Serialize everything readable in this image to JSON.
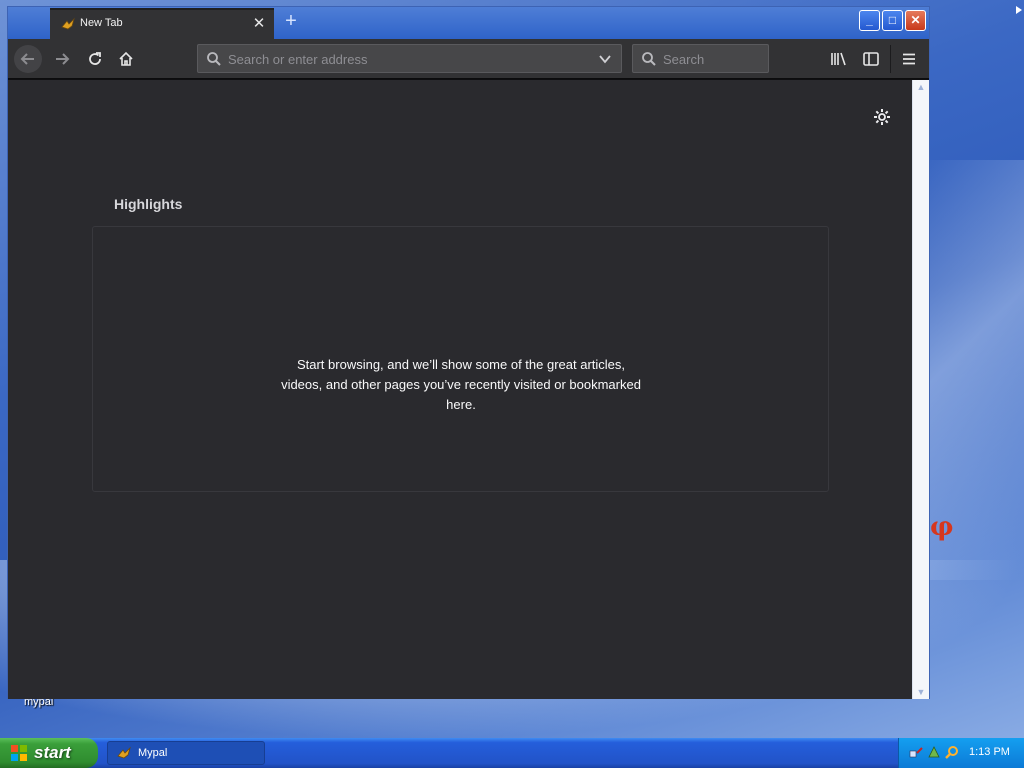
{
  "desktop": {
    "icon_label": "mypal"
  },
  "browser": {
    "tab": {
      "title": "New Tab",
      "close_symbol": "✕"
    },
    "new_tab_symbol": "+",
    "window_controls": {
      "minimize": "_",
      "maximize": "□",
      "close": "✕"
    },
    "urlbar": {
      "placeholder": "Search or enter address",
      "value": ""
    },
    "searchbar": {
      "placeholder": "Search",
      "value": ""
    },
    "icons": {
      "back": "back-arrow-icon",
      "forward": "forward-arrow-icon",
      "reload": "reload-icon",
      "home": "home-icon",
      "library": "library-icon",
      "sidebar": "sidebar-icon",
      "menu": "hamburger-menu-icon",
      "settings": "gear-icon"
    }
  },
  "newtab": {
    "highlights_title": "Highlights",
    "highlights_empty": "Start browsing, and we’ll show some of the great articles, videos, and other pages you’ve recently visited or bookmarked here."
  },
  "taskbar": {
    "start_label": "start",
    "task_label": "Mypal",
    "clock": "1:13 PM"
  },
  "colors": {
    "content_bg": "#2a2a2e",
    "toolbar_bg": "#323234",
    "xp_blue": "#245edb",
    "start_green": "#3a9f3a"
  }
}
